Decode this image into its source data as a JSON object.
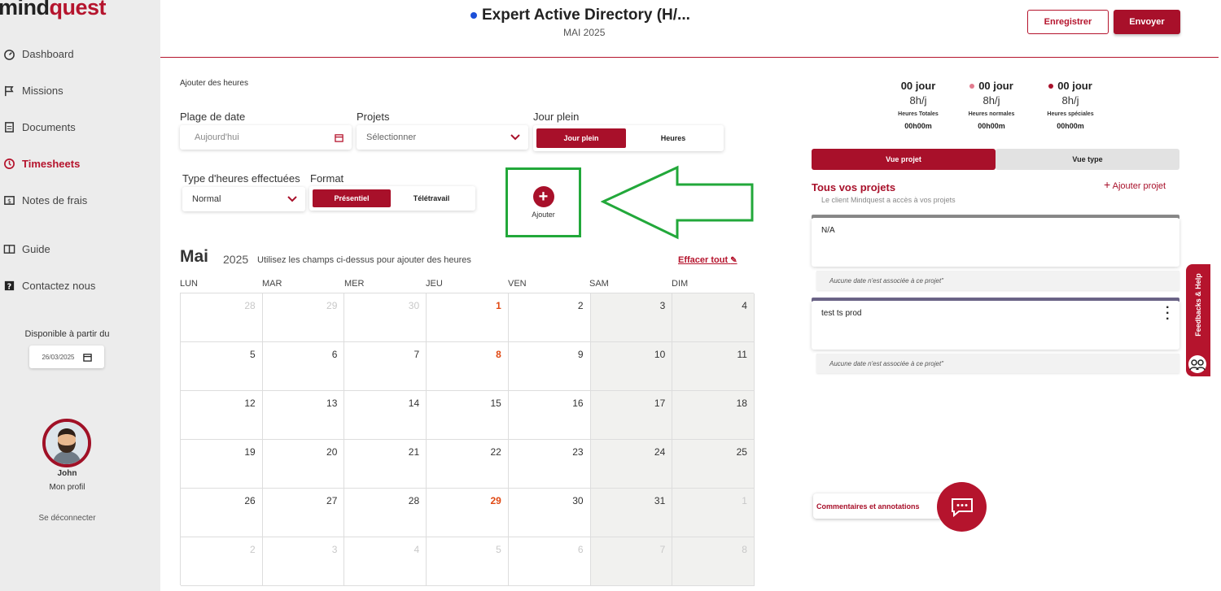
{
  "brand": {
    "part1": "mind",
    "part2": "quest"
  },
  "sidebar": {
    "items": [
      {
        "label": "Dashboard",
        "icon": "gauge-icon"
      },
      {
        "label": "Missions",
        "icon": "flag-icon"
      },
      {
        "label": "Documents",
        "icon": "document-icon"
      },
      {
        "label": "Timesheets",
        "icon": "clock-icon"
      },
      {
        "label": "Notes de frais",
        "icon": "money-icon"
      },
      {
        "label": "Guide",
        "icon": "book-icon"
      },
      {
        "label": "Contactez nous",
        "icon": "question-icon"
      }
    ],
    "availability_label": "Disponible à partir du",
    "availability_date": "26/03/2025",
    "profile_name": "John",
    "profile_link": "Mon profil",
    "logout": "Se déconnecter"
  },
  "header": {
    "title": "Expert Active Directory (H/...",
    "subtitle": "MAI 2025",
    "save_label": "Enregistrer",
    "send_label": "Envoyer"
  },
  "form": {
    "section_title": "Ajouter des heures",
    "date_label": "Plage de date",
    "date_placeholder": "Aujourd'hui",
    "projects_label": "Projets",
    "projects_value": "Sélectionner",
    "fullday_label": "Jour plein",
    "fullday_on": "Jour plein",
    "fullday_off": "Heures",
    "hours_type_label": "Type d'heures effectuées",
    "hours_type_value": "Normal",
    "format_label": "Format",
    "format_on": "Présentiel",
    "format_off": "Télétravail",
    "add_label": "Ajouter"
  },
  "calendar": {
    "month": "Mai",
    "year": "2025",
    "hint": "Utilisez les champs ci-dessus pour ajouter des heures",
    "clear_label": "Effacer tout",
    "weekdays": [
      "LUN",
      "MAR",
      "MER",
      "JEU",
      "VEN",
      "SAM",
      "DIM"
    ],
    "weeks": [
      [
        {
          "d": "28",
          "t": "muted"
        },
        {
          "d": "29",
          "t": "muted"
        },
        {
          "d": "30",
          "t": "muted"
        },
        {
          "d": "1",
          "t": "red"
        },
        {
          "d": "2",
          "t": ""
        },
        {
          "d": "3",
          "t": "we"
        },
        {
          "d": "4",
          "t": "we"
        }
      ],
      [
        {
          "d": "5",
          "t": ""
        },
        {
          "d": "6",
          "t": ""
        },
        {
          "d": "7",
          "t": ""
        },
        {
          "d": "8",
          "t": "red"
        },
        {
          "d": "9",
          "t": ""
        },
        {
          "d": "10",
          "t": "we"
        },
        {
          "d": "11",
          "t": "we"
        }
      ],
      [
        {
          "d": "12",
          "t": ""
        },
        {
          "d": "13",
          "t": ""
        },
        {
          "d": "14",
          "t": ""
        },
        {
          "d": "15",
          "t": ""
        },
        {
          "d": "16",
          "t": ""
        },
        {
          "d": "17",
          "t": "we"
        },
        {
          "d": "18",
          "t": "we"
        }
      ],
      [
        {
          "d": "19",
          "t": ""
        },
        {
          "d": "20",
          "t": ""
        },
        {
          "d": "21",
          "t": ""
        },
        {
          "d": "22",
          "t": ""
        },
        {
          "d": "23",
          "t": ""
        },
        {
          "d": "24",
          "t": "we"
        },
        {
          "d": "25",
          "t": "we"
        }
      ],
      [
        {
          "d": "26",
          "t": ""
        },
        {
          "d": "27",
          "t": ""
        },
        {
          "d": "28",
          "t": ""
        },
        {
          "d": "29",
          "t": "red"
        },
        {
          "d": "30",
          "t": ""
        },
        {
          "d": "31",
          "t": "we"
        },
        {
          "d": "1",
          "t": "we muted"
        }
      ],
      [
        {
          "d": "2",
          "t": "muted"
        },
        {
          "d": "3",
          "t": "muted"
        },
        {
          "d": "4",
          "t": "muted"
        },
        {
          "d": "5",
          "t": "muted"
        },
        {
          "d": "6",
          "t": "muted"
        },
        {
          "d": "7",
          "t": "we muted"
        },
        {
          "d": "8",
          "t": "we muted"
        }
      ]
    ]
  },
  "stats": [
    {
      "value": "00 jour",
      "rate": "8h/j",
      "caption": "Heures Totales",
      "time": "00h00m",
      "dot": ""
    },
    {
      "value": "00 jour",
      "rate": "8h/j",
      "caption": "Heures normales",
      "time": "00h00m",
      "dot": "#e27b8e"
    },
    {
      "value": "00 jour",
      "rate": "8h/j",
      "caption": "Heures spéciales",
      "time": "00h00m",
      "dot": "#a8102a"
    }
  ],
  "views": {
    "project": "Vue projet",
    "type": "Vue type"
  },
  "projects_panel": {
    "title": "Tous vos projets",
    "subtitle": "Le client Mindquest a accès à vos projets",
    "add_label": "Ajouter projet",
    "projects": [
      {
        "name": "N/A",
        "note": "Aucune date n'est associée à ce projet\"",
        "color": "#8a8a8a"
      },
      {
        "name": "test ts prod",
        "note": "Aucune date n'est associée à ce projet\"",
        "color": "#6b6488"
      }
    ]
  },
  "comments_label": "Commentaires et annotations",
  "feedback_label": "Feedbacks & Help",
  "colors": {
    "accent": "#a8102a",
    "highlight": "#22a83a"
  }
}
